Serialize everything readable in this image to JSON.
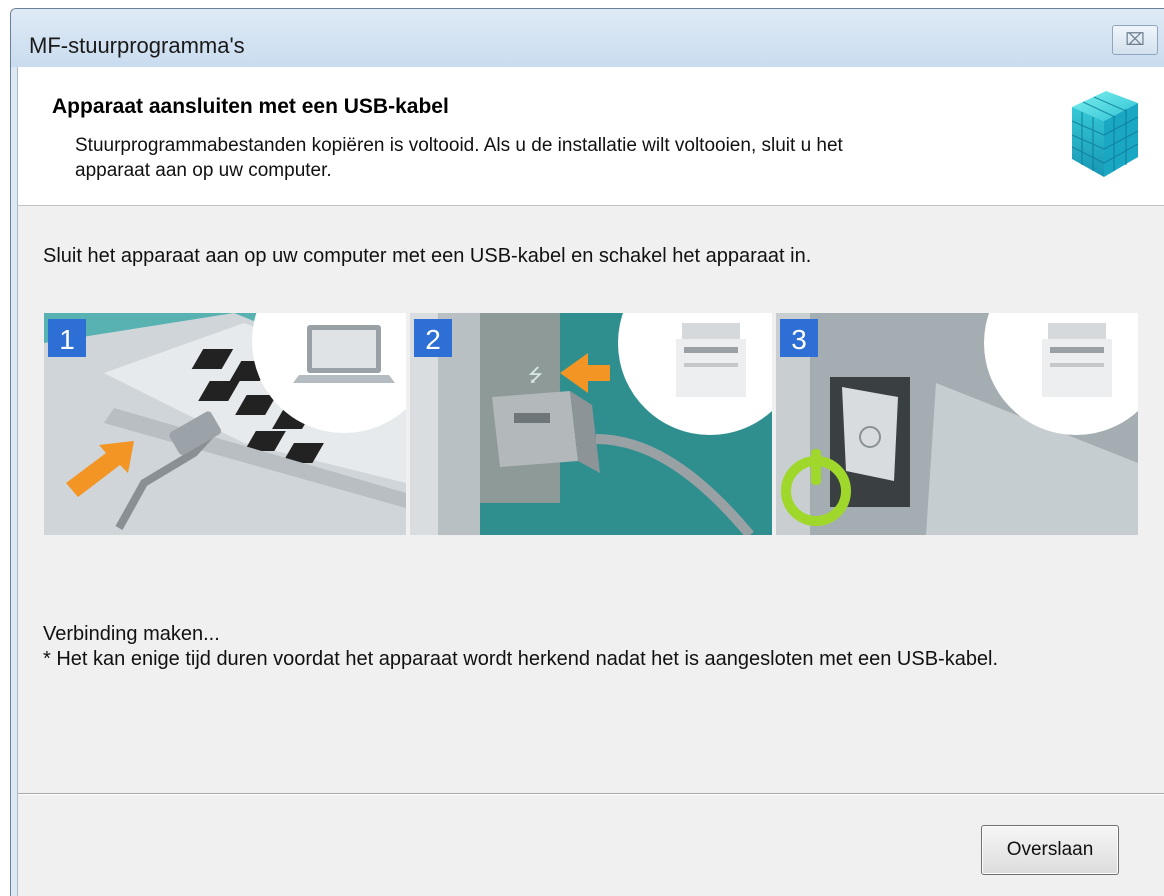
{
  "window": {
    "title": "MF-stuurprogramma's",
    "close_label": "⌧"
  },
  "header": {
    "title": "Apparaat aansluiten met een USB-kabel",
    "description": "Stuurprogrammabestanden kopiëren is voltooid. Als u de installatie wilt voltooien, sluit u het apparaat aan op uw computer.",
    "icon": "cube-installer-icon"
  },
  "instruction": "Sluit het apparaat aan op uw computer met een USB-kabel en schakel het apparaat in.",
  "steps": [
    {
      "number": "1",
      "icon": "laptop-usb-illustration"
    },
    {
      "number": "2",
      "icon": "printer-usb-port-illustration"
    },
    {
      "number": "3",
      "icon": "printer-power-switch-illustration"
    }
  ],
  "status": {
    "line": "Verbinding maken...",
    "note": "* Het kan enige tijd duren voordat het apparaat wordt herkend nadat het is aangesloten met een USB-kabel."
  },
  "footer": {
    "skip_label": "Overslaan"
  },
  "colors": {
    "step_badge": "#2e6fd6",
    "arrow": "#f08a1c",
    "power_ring": "#9fd82a"
  }
}
